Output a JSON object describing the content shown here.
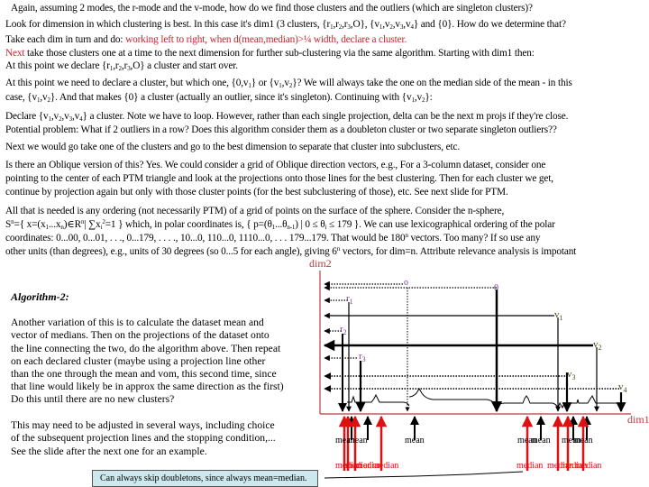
{
  "intro": {
    "line1": "Again, assuming 2 modes, the r-mode and the v-mode, how do we find those clusters and the outliers (which are singleton clusters)?",
    "line2_a": "Look for dimension in which clustering is best.  In this case it's dim1 (3 clusters, {r",
    "line2_b": ",r",
    "line2_c": ",r",
    "line2_d": ",O}, {v",
    "line2_e": ",v",
    "line2_f": ",v",
    "line2_g": ",v",
    "line2_h": "} and {0}.  How do we determine that?",
    "line3_a": "Take each dim in turn and do: ",
    "line3_red": "working left to right, when d(mean,median)>¼ width, declare a cluster.",
    "line4_red": "Next",
    "line4_b": " take those clusters one at a time to the next dimension for further sub-clustering via the same algorithm.  Starting with dim1 then:",
    "line5_a": "At this point we declare {r",
    "line5_b": ",r",
    "line5_c": ",r",
    "line5_d": ",O} a cluster and start over."
  },
  "para2": {
    "line1_a": "At this point we need to declare a cluster, but which one, {0,v",
    "line1_b": "} or {v",
    "line1_c": ",v",
    "line1_d": "}?  We will always take the one on the median side of the mean - in this",
    "line2_a": "case, {v",
    "line2_b": ",v",
    "line2_c": "}.  And that makes {0} a cluster (actually an outlier, since it's singleton).  Continuing with {v",
    "line2_d": ",v",
    "line2_e": "}:"
  },
  "para3": {
    "line1_a": "Declare {v",
    "line1_b": ",v",
    "line1_c": ",v",
    "line1_d": ",v",
    "line1_e": "} a cluster.  Note we have to loop.  However, rather than each single projection, delta can be the next m projs if they're close.",
    "line2": "Potential problem:  What if 2 outliers in a row?  Does this algorithm consider them as a doubleton cluster or two separate singleton outliers??"
  },
  "para4": "Next we would go take one of the clusters and go to the best dimension to separate that cluster into subclusters, etc.",
  "para5": {
    "line1": "Is there an Oblique version of this?  Yes.  We could consider a grid of Oblique direction vectors, e.g., For a 3-column dataset, consider one",
    "line2": "pointing to the center of each PTM triangle and look at the projections onto those lines for the best clustering.  Then for each cluster we get,",
    "line3": "continue by projection again but only with those cluster points (for the best subclustering of those), etc.  See next slide for PTM."
  },
  "para6": {
    "line1": "All that is needed is any ordering (not necessarily PTM) of a grid of points on the surface of the sphere.  Consider the n-sphere,",
    "line2_a": "S",
    "line2_b": "={ x=(x",
    "line2_c": "...x",
    "line2_d": ")∈R",
    "line2_e": "| ∑x",
    "line2_f": "=1 } which, in polar coordinates is, { p=(θ",
    "line2_g": "...θ",
    "line2_h": ")  |  0 ≤ θ",
    "line2_i": " ≤ 179 }.  We can use lexicographical ordering of the polar",
    "line3_a": "coordinates:  0...00,  0...01, . . ., 0...179,  .  .  .  ., 10...0, 110...0, 1110...0, . . .  179...179.  That would be 180",
    "line3_b": " vectors. Too many?  If so use any",
    "line4_a": "other units (than degrees), e.g., units of 30 degrees (so 0...5 for each angle), giving 6",
    "line4_b": " vectors, for dim=n.  Attribute relevance analysis is impotant"
  },
  "algorithm": {
    "title": "Algorithm-2:",
    "lines": [
      "Another variation of this is to calculate the dataset mean and",
      "vector of medians.  Then on the projections of the dataset onto",
      "the line connecting the two, do the algorithm above.  Then repeat",
      "on each declared cluster (maybe using a projection line other",
      "than the one through the mean and vom, this second time, since",
      "that line would likely be in approx the same direction as the first)",
      "Do this until there are no new clusters?"
    ],
    "lines2": [
      "This may need to be adjusted in several ways, including choice",
      "of the subsequent projection lines and the stopping condition,...",
      "See the slide after the next one for an example."
    ]
  },
  "note_box": "Can always skip doubletons, since always mean=median.",
  "diagram": {
    "axis_y_label": "dim2",
    "axis_x_label": "dim1",
    "colors": {
      "axis": "#b5403f",
      "point_label": "#6a3d9a",
      "v_label": "#4a4a1a",
      "median": "#dd1111",
      "text_red": "#c0262c"
    },
    "points": [
      {
        "name": "O",
        "label": "o",
        "kind": "r"
      },
      {
        "name": "0",
        "label": "0",
        "kind": "v"
      },
      {
        "name": "r1",
        "label": "r",
        "sub": "1",
        "kind": "r"
      },
      {
        "name": "r2",
        "label": "r",
        "sub": "2",
        "kind": "r"
      },
      {
        "name": "r3",
        "label": "r",
        "sub": "3",
        "kind": "r"
      },
      {
        "name": "v1",
        "label": "v",
        "sub": "1",
        "kind": "v"
      },
      {
        "name": "v2",
        "label": "v",
        "sub": "2",
        "kind": "v"
      },
      {
        "name": "v3",
        "label": "v",
        "sub": "3",
        "kind": "v"
      },
      {
        "name": "v4",
        "label": "v",
        "sub": "4",
        "kind": "v"
      }
    ],
    "mean_labels": [
      "mean",
      "mean",
      "mean",
      "mean",
      "mean",
      "mean",
      "mean"
    ],
    "median_labels": [
      "median",
      "median",
      "median",
      "median",
      "median",
      "median",
      "median",
      "median"
    ]
  }
}
